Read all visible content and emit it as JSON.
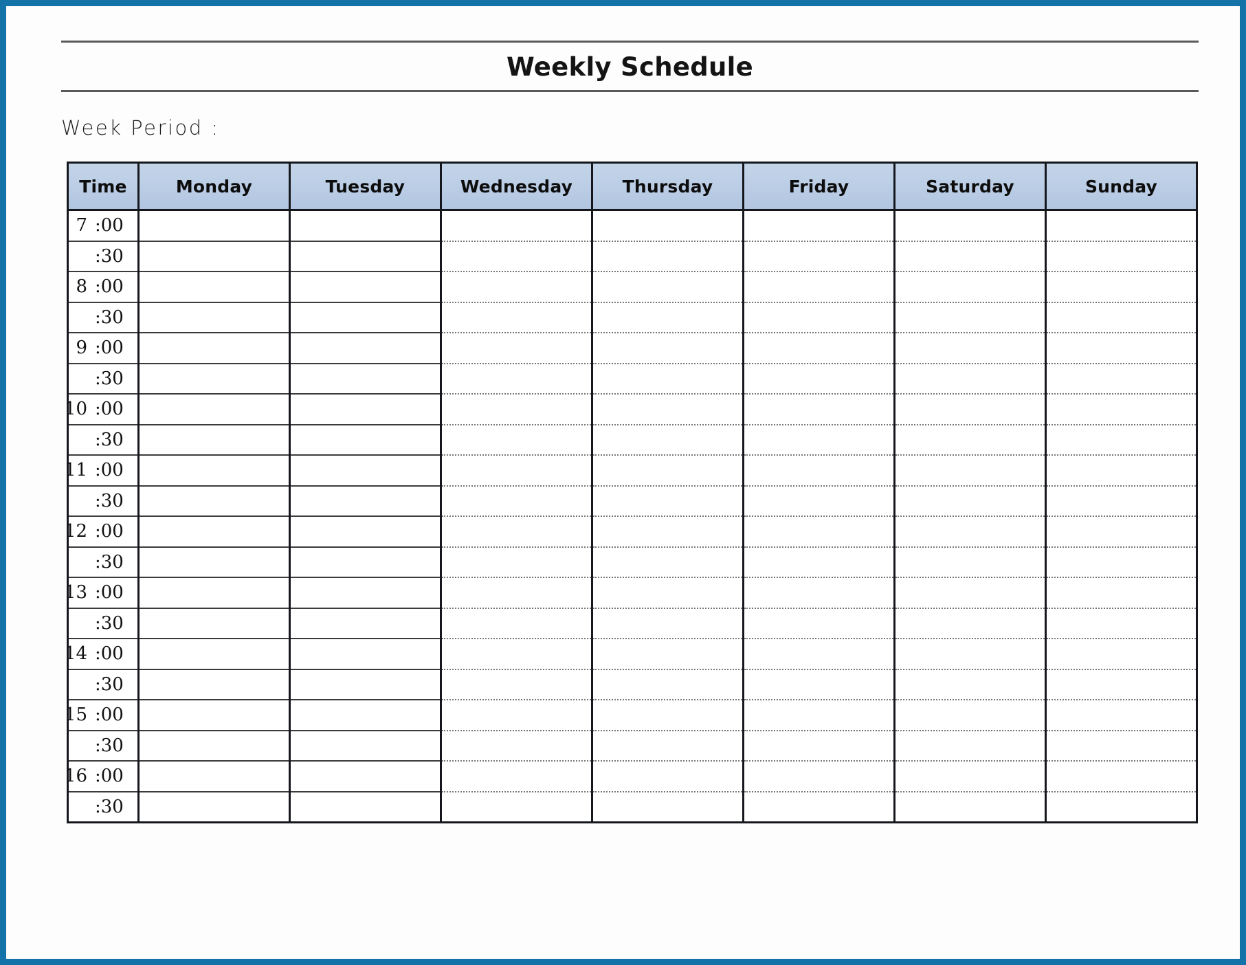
{
  "page": {
    "border_color": "#1372a8",
    "background": "#ffffff"
  },
  "header": {
    "title": "Weekly Schedule",
    "week_period_label": "Week Period :"
  },
  "table": {
    "header_background": "#b9cde5",
    "columns": [
      {
        "key": "time",
        "label": "Time"
      },
      {
        "key": "monday",
        "label": "Monday"
      },
      {
        "key": "tuesday",
        "label": "Tuesday"
      },
      {
        "key": "wednesday",
        "label": "Wednesday"
      },
      {
        "key": "thursday",
        "label": "Thursday"
      },
      {
        "key": "friday",
        "label": "Friday"
      },
      {
        "key": "saturday",
        "label": "Saturday"
      },
      {
        "key": "sunday",
        "label": "Sunday"
      }
    ],
    "rows": [
      {
        "hour": "7",
        "minute": ":00"
      },
      {
        "hour": "",
        "minute": ":30"
      },
      {
        "hour": "8",
        "minute": ":00"
      },
      {
        "hour": "",
        "minute": ":30"
      },
      {
        "hour": "9",
        "minute": ":00"
      },
      {
        "hour": "",
        "minute": ":30"
      },
      {
        "hour": "10",
        "minute": ":00"
      },
      {
        "hour": "",
        "minute": ":30"
      },
      {
        "hour": "11",
        "minute": ":00"
      },
      {
        "hour": "",
        "minute": ":30"
      },
      {
        "hour": "12",
        "minute": ":00"
      },
      {
        "hour": "",
        "minute": ":30"
      },
      {
        "hour": "13",
        "minute": ":00"
      },
      {
        "hour": "",
        "minute": ":30"
      },
      {
        "hour": "14",
        "minute": ":00"
      },
      {
        "hour": "",
        "minute": ":30"
      },
      {
        "hour": "15",
        "minute": ":00"
      },
      {
        "hour": "",
        "minute": ":30"
      },
      {
        "hour": "16",
        "minute": ":00"
      },
      {
        "hour": "",
        "minute": ":30"
      }
    ],
    "entries": []
  }
}
